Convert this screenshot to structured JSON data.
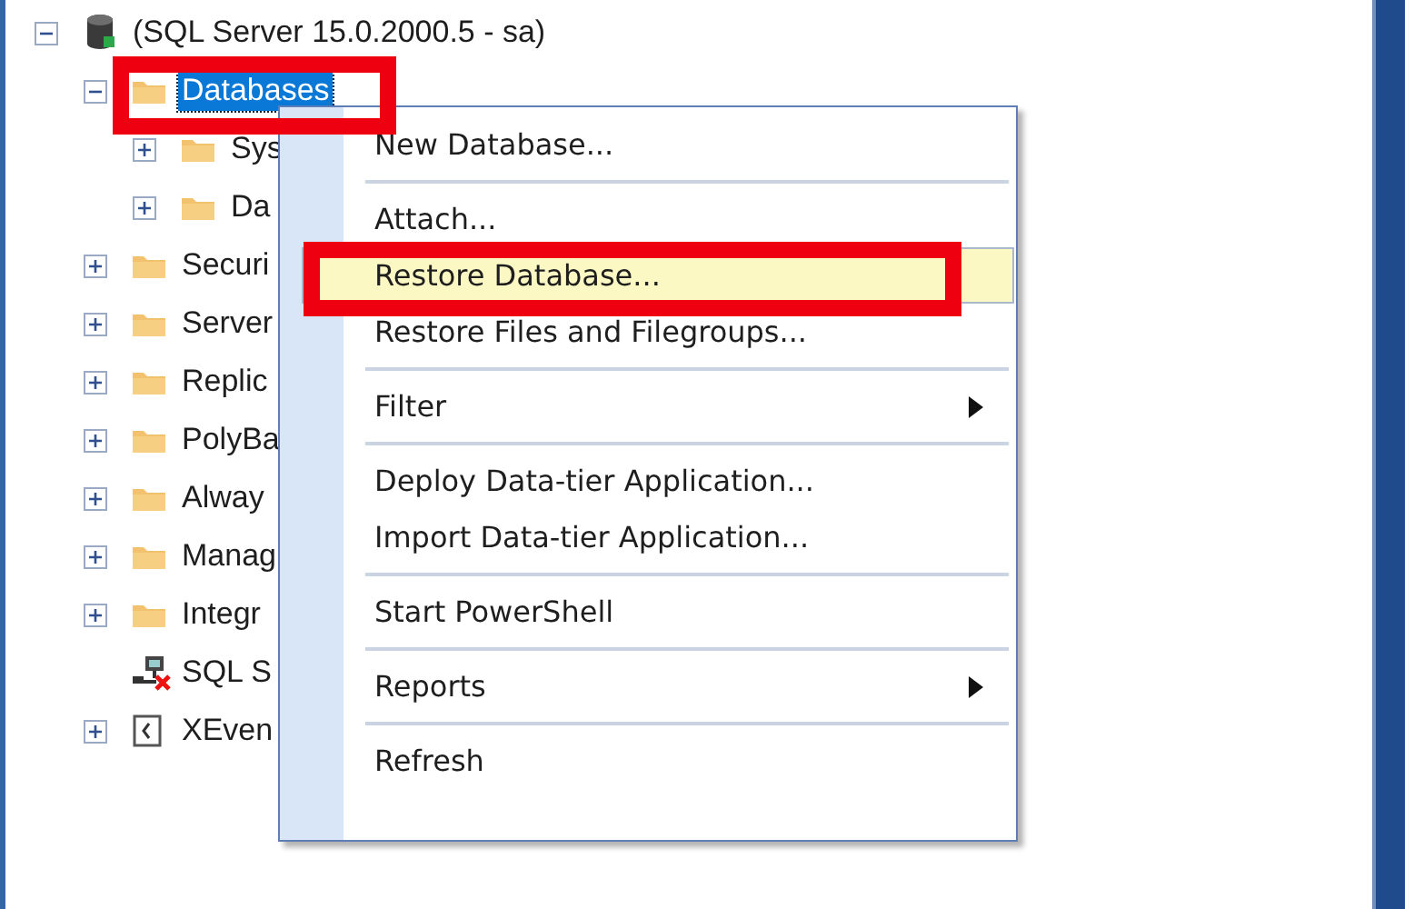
{
  "tree": [
    {
      "label": "(SQL Server 15.0.2000.5 - sa)",
      "kind": "server",
      "leaf": false,
      "expanded": true,
      "selected": false,
      "annotated": false,
      "children": [
        {
          "label": "Databases",
          "kind": "folder",
          "leaf": false,
          "expanded": true,
          "selected": true,
          "annotated": true,
          "children": [
            {
              "label": "Sys",
              "kind": "folder",
              "leaf": false,
              "expanded": false,
              "selected": false,
              "annotated": false
            },
            {
              "label": "Da",
              "kind": "folder",
              "leaf": false,
              "expanded": false,
              "selected": false,
              "annotated": false
            }
          ]
        },
        {
          "label": "Securi",
          "kind": "folder",
          "leaf": false,
          "expanded": false,
          "selected": false,
          "annotated": false
        },
        {
          "label": "Server",
          "kind": "folder",
          "leaf": false,
          "expanded": false,
          "selected": false,
          "annotated": false
        },
        {
          "label": "Replic",
          "kind": "folder",
          "leaf": false,
          "expanded": false,
          "selected": false,
          "annotated": false
        },
        {
          "label": "PolyBa",
          "kind": "folder",
          "leaf": false,
          "expanded": false,
          "selected": false,
          "annotated": false
        },
        {
          "label": "Alway",
          "kind": "folder",
          "leaf": false,
          "expanded": false,
          "selected": false,
          "annotated": false
        },
        {
          "label": "Manag",
          "kind": "folder",
          "leaf": false,
          "expanded": false,
          "selected": false,
          "annotated": false
        },
        {
          "label": "Integr",
          "kind": "folder",
          "leaf": false,
          "expanded": false,
          "selected": false,
          "annotated": false
        },
        {
          "label": "SQL S",
          "kind": "agent",
          "leaf": true,
          "expanded": false,
          "selected": false,
          "annotated": false
        },
        {
          "label": "XEven",
          "kind": "xevent",
          "leaf": false,
          "expanded": false,
          "selected": false,
          "annotated": false
        }
      ]
    }
  ],
  "context_menu": [
    {
      "kind": "item",
      "label": "New Database...",
      "selected": false,
      "annotated": false
    },
    {
      "kind": "separator"
    },
    {
      "kind": "item",
      "label": "Attach...",
      "selected": false,
      "annotated": false
    },
    {
      "kind": "item",
      "label": "Restore Database...",
      "selected": true,
      "annotated": true
    },
    {
      "kind": "item",
      "label": "Restore Files and Filegroups...",
      "selected": false,
      "annotated": false
    },
    {
      "kind": "separator"
    },
    {
      "kind": "submenu",
      "label": "Filter",
      "selected": false,
      "annotated": false
    },
    {
      "kind": "separator"
    },
    {
      "kind": "item",
      "label": "Deploy Data-tier Application...",
      "selected": false,
      "annotated": false
    },
    {
      "kind": "item",
      "label": "Import Data-tier Application...",
      "selected": false,
      "annotated": false
    },
    {
      "kind": "separator"
    },
    {
      "kind": "item",
      "label": "Start PowerShell",
      "selected": false,
      "annotated": false
    },
    {
      "kind": "separator"
    },
    {
      "kind": "submenu",
      "label": "Reports",
      "selected": false,
      "annotated": false
    },
    {
      "kind": "separator"
    },
    {
      "kind": "item",
      "label": "Refresh",
      "selected": false,
      "annotated": false
    }
  ]
}
